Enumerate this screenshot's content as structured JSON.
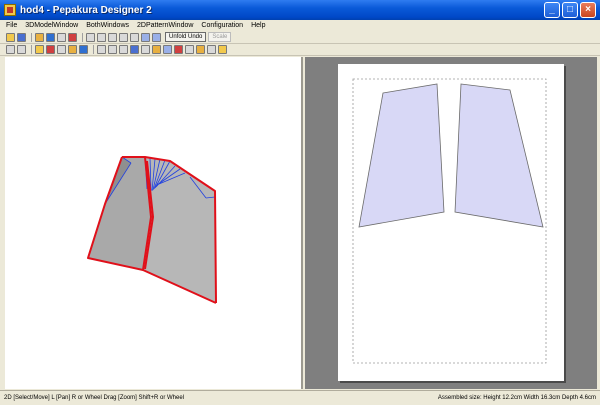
{
  "window": {
    "title": "hod4 - Pepakura Designer 2",
    "minimize_label": "_",
    "maximize_label": "□",
    "close_label": "×"
  },
  "menu": {
    "items": [
      {
        "label": "File"
      },
      {
        "label": "3DModelWindow"
      },
      {
        "label": "BothWindows"
      },
      {
        "label": "2DPatternWindow"
      },
      {
        "label": "Configuration"
      },
      {
        "label": "Help"
      }
    ]
  },
  "toolbar": {
    "unfold_undo_label": "Unfold Undo",
    "scale_label": "Scale"
  },
  "status": {
    "left": "2D [Select/Move] L [Pan] R or Wheel Drag [Zoom] Shift+R or Wheel",
    "right": "Assembled size: Height 12.2cm Width 16.3cm Depth 4.6cm"
  },
  "colors": {
    "titlebar": "#0a5ad8",
    "pattern_fill": "#d8d8f6",
    "model_outline": "#e0101a",
    "fold_lines": "#2040e0"
  }
}
